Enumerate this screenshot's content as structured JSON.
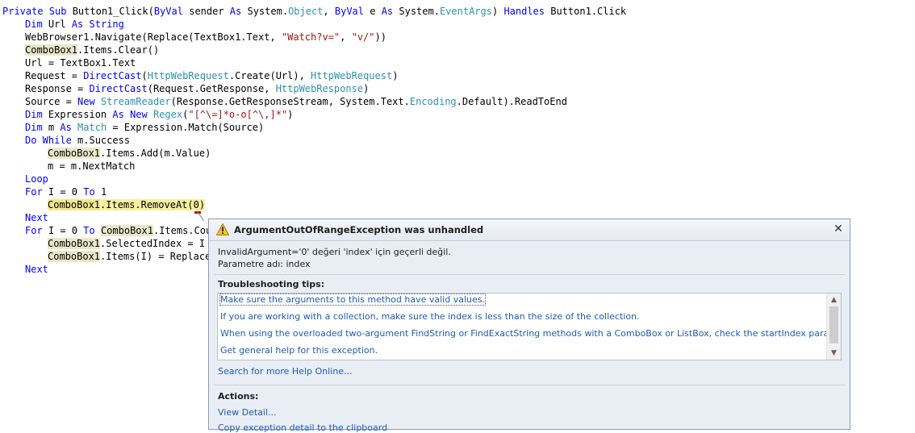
{
  "code": {
    "lines": [
      [
        {
          "t": "Private Sub ",
          "c": "kw"
        },
        {
          "t": "Button1_Click("
        },
        {
          "t": "ByVal ",
          "c": "kw"
        },
        {
          "t": "sender "
        },
        {
          "t": "As ",
          "c": "kw"
        },
        {
          "t": "System."
        },
        {
          "t": "Object",
          "c": "ty"
        },
        {
          "t": ", "
        },
        {
          "t": "ByVal ",
          "c": "kw"
        },
        {
          "t": "e "
        },
        {
          "t": "As ",
          "c": "kw"
        },
        {
          "t": "System."
        },
        {
          "t": "EventArgs",
          "c": "ty"
        },
        {
          "t": ") "
        },
        {
          "t": "Handles ",
          "c": "kw"
        },
        {
          "t": "Button1.Click"
        }
      ],
      [
        {
          "t": "Dim ",
          "c": "kw"
        },
        {
          "t": "Url "
        },
        {
          "t": "As ",
          "c": "kw"
        },
        {
          "t": "String",
          "c": "kw"
        }
      ],
      [
        {
          "t": "WebBrowser1.Navigate(Replace(TextBox1.Text, "
        },
        {
          "t": "\"Watch?v=\"",
          "c": "st"
        },
        {
          "t": ", "
        },
        {
          "t": "\"v/\"",
          "c": "st"
        },
        {
          "t": "))"
        }
      ],
      [
        {
          "t": "ComboBox1",
          "c": "hl"
        },
        {
          "t": ".Items.Clear()"
        }
      ],
      [
        {
          "t": "Url = TextBox1.Text"
        }
      ],
      [
        {
          "t": "Request = "
        },
        {
          "t": "DirectCast",
          "c": "kw"
        },
        {
          "t": "("
        },
        {
          "t": "HttpWebRequest",
          "c": "ty"
        },
        {
          "t": ".Create(Url), "
        },
        {
          "t": "HttpWebRequest",
          "c": "ty"
        },
        {
          "t": ")"
        }
      ],
      [
        {
          "t": "Response = "
        },
        {
          "t": "DirectCast",
          "c": "kw"
        },
        {
          "t": "(Request.GetResponse, "
        },
        {
          "t": "HttpWebResponse",
          "c": "ty"
        },
        {
          "t": ")"
        }
      ],
      [
        {
          "t": "Source = "
        },
        {
          "t": "New ",
          "c": "kw"
        },
        {
          "t": "StreamReader",
          "c": "ty"
        },
        {
          "t": "(Response.GetResponseStream, System.Text."
        },
        {
          "t": "Encoding",
          "c": "ty"
        },
        {
          "t": ".Default).ReadToEnd"
        }
      ],
      [
        {
          "t": "Dim ",
          "c": "kw"
        },
        {
          "t": "Expression "
        },
        {
          "t": "As ",
          "c": "kw"
        },
        {
          "t": "New ",
          "c": "kw"
        },
        {
          "t": "Regex",
          "c": "ty"
        },
        {
          "t": "("
        },
        {
          "t": "\"[^\\=]*o-o[^\\,]*\"",
          "c": "st"
        },
        {
          "t": ")"
        }
      ],
      [
        {
          "t": "Dim ",
          "c": "kw"
        },
        {
          "t": "m "
        },
        {
          "t": "As ",
          "c": "kw"
        },
        {
          "t": "Match",
          "c": "ty"
        },
        {
          "t": " = Expression.Match(Source)"
        }
      ],
      [
        {
          "t": "Do While ",
          "c": "kw"
        },
        {
          "t": "m.Success"
        }
      ],
      [
        {
          "t": "ComboBox1",
          "c": "hl"
        },
        {
          "t": ".Items.Add(m.Value)"
        }
      ],
      [
        {
          "t": "m = m.NextMatch"
        }
      ],
      [
        {
          "t": "Loop",
          "c": "kw"
        }
      ],
      [
        {
          "t": "For ",
          "c": "kw"
        },
        {
          "t": "I = 0 "
        },
        {
          "t": "To ",
          "c": "kw"
        },
        {
          "t": "1"
        }
      ],
      [
        {
          "t": "ComboBox1",
          "c": "hl"
        },
        {
          "t": ".Items.RemoveAt(0)"
        }
      ],
      [
        {
          "t": "Next",
          "c": "kw"
        }
      ],
      [
        {
          "t": "For ",
          "c": "kw"
        },
        {
          "t": "I = 0 "
        },
        {
          "t": "To ",
          "c": "kw"
        },
        {
          "t": "ComboBox1",
          "c": "hl"
        },
        {
          "t": ".Items.Cou"
        }
      ],
      [
        {
          "t": "ComboBox1",
          "c": "hl"
        },
        {
          "t": ".SelectedIndex = I"
        }
      ],
      [
        {
          "t": "ComboBox1",
          "c": "hl"
        },
        {
          "t": ".Items(I) = Replace("
        }
      ],
      [
        {
          "t": "Next",
          "c": "kw"
        }
      ]
    ],
    "indent_levels": [
      0,
      1,
      1,
      1,
      1,
      1,
      1,
      1,
      1,
      1,
      1,
      2,
      2,
      1,
      1,
      2,
      1,
      1,
      2,
      2,
      1
    ],
    "current_line": 15
  },
  "exception": {
    "title": "ArgumentOutOfRangeException was unhandled",
    "close_label": "✕",
    "message_line1": "InvalidArgument='0' değeri 'index' için geçerli değil.",
    "message_line2": "Parametre adı: index",
    "tips_heading": "Troubleshooting tips:",
    "tips": [
      "Make sure the arguments to this method have valid values.",
      "If you are working with a collection, make sure the index is less than the size of the collection.",
      "When using the overloaded two-argument FindString or FindExactString methods with a ComboBox or ListBox, check the startIndex parameter.",
      "Get general help for this exception."
    ],
    "search_link": "Search for more Help Online...",
    "actions_heading": "Actions:",
    "actions": [
      "View Detail...",
      "Copy exception detail to the clipboard"
    ],
    "scroll_up_glyph": "▲",
    "scroll_down_glyph": "▼"
  },
  "icons": {
    "warning": "warning-icon",
    "close": "close-icon",
    "scroll_up": "chevron-up-icon",
    "scroll_down": "chevron-down-icon"
  },
  "colors": {
    "keyword": "#0000ff",
    "type": "#2b91af",
    "string": "#a31515",
    "link": "#1c5bb8",
    "squiggle": "#c00000"
  }
}
